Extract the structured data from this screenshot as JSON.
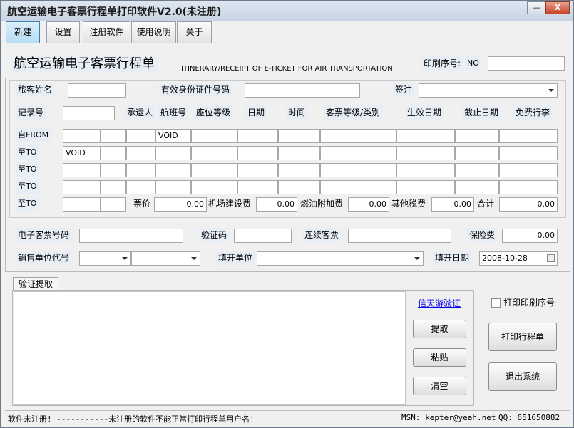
{
  "window": {
    "title": "航空运输电子客票行程单打印软件V2.0(未注册)",
    "minimize": "—",
    "close": "X"
  },
  "toolbar": {
    "new": "新建",
    "settings": "设置",
    "register": "注册软件",
    "help": "使用说明",
    "about": "关于"
  },
  "header": {
    "title_cn": "航空运输电子客票行程单",
    "title_en": "ITINERARY/RECEIPT OF E-TICKET FOR AIR TRANSPORTATION",
    "print_serial_label": "印刷序号:",
    "print_serial_prefix": "NO",
    "print_serial_value": ""
  },
  "passenger": {
    "name_label": "旅客姓名",
    "name_value": "",
    "id_label": "有效身份证件号码",
    "id_value": "",
    "endorse_label": "签注",
    "endorse_value": ""
  },
  "columns": {
    "record": "记录号",
    "carrier": "承运人",
    "flight": "航班号",
    "seat": "座位等级",
    "date": "日期",
    "time": "时间",
    "fare_basis": "客票等级/类别",
    "valid_from": "生效日期",
    "valid_to": "截止日期",
    "baggage": "免费行李"
  },
  "record_value": "",
  "segments": [
    {
      "label": "自FROM",
      "carrier": "",
      "flight": "VOID"
    },
    {
      "label": "至TO",
      "city": "VOID"
    },
    {
      "label": "至TO"
    },
    {
      "label": "至TO"
    },
    {
      "label": "至TO"
    }
  ],
  "fees": {
    "fare_label": "票价",
    "fare_value": "0.00",
    "airport_label": "机场建设费",
    "airport_value": "0.00",
    "fuel_label": "燃油附加费",
    "fuel_value": "0.00",
    "other_label": "其他税费",
    "other_value": "0.00",
    "total_label": "合计",
    "total_value": "0.00"
  },
  "ticket": {
    "eticket_label": "电子客票号码",
    "eticket_value": "",
    "verify_label": "验证码",
    "verify_value": "",
    "conj_label": "连续客票",
    "conj_value": "",
    "insurance_label": "保险费",
    "insurance_value": "0.00",
    "agent_label": "销售单位代号",
    "issuer_label": "填开单位",
    "issue_date_label": "填开日期",
    "issue_date_value": "2008-10-28"
  },
  "verify_panel": {
    "tab": "验证提取",
    "link": "信天游验证",
    "extract": "提取",
    "paste": "粘贴",
    "clear": "清空"
  },
  "side": {
    "print_serial_check": "打印印刷序号",
    "print_button": "打印行程单",
    "exit_button": "退出系统"
  },
  "status": {
    "left": "软件未注册! -----------未注册的软件不能正常打印行程单用户名!",
    "msn": "MSN: kepter@yeah.net",
    "qq": "QQ: 651650882"
  }
}
